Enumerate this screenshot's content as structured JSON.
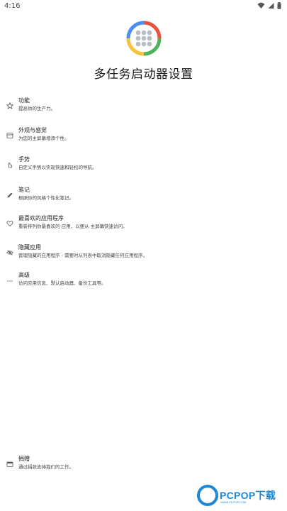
{
  "status_bar": {
    "time": "4:16",
    "icons": [
      "wifi-icon",
      "signal-icon",
      "battery-icon"
    ]
  },
  "app": {
    "title": "多任务启动器设置",
    "logo_icon": "app-grid-logo-icon"
  },
  "settings": [
    {
      "title": "功能",
      "subtitle": "提高你的生产力。",
      "icon": "star-icon"
    },
    {
      "title": "外观与感觉",
      "subtitle": "为您的主屏幕增添个性。",
      "icon": "palette-icon"
    },
    {
      "title": "手势",
      "subtitle": "自定义手势以实现快速和轻松的导航。",
      "icon": "gesture-hand-icon"
    },
    {
      "title": "笔记",
      "subtitle": "根据你的风格个性化笔记。",
      "icon": "pencil-icon"
    },
    {
      "title": "最喜欢的应用程序",
      "subtitle": "重新排列你最喜欢的 应用，以便从 主屏幕快速访问。",
      "icon": "heart-icon"
    },
    {
      "title": "隐藏应用",
      "subtitle": "管理隐藏的应用程序 - 需要时从列表中取消隐藏任何应用程序。",
      "icon": "eye-hidden-icon"
    },
    {
      "title": "高级",
      "subtitle": "访问应用信息、默认启动器、备份工具等。",
      "icon": "more-icon"
    }
  ],
  "about": {
    "title": "捐赠",
    "subtitle": "通过捐款支持我们的工作。",
    "icon": "donate-icon"
  },
  "watermark": {
    "brand": "PCPOP下载",
    "sub": "WWW.PCPOP.COM"
  },
  "colors": {
    "logo_red": "#e8543f",
    "logo_yellow": "#f6c33b",
    "logo_green": "#4fb35b",
    "logo_blue": "#4d8ef0",
    "logo_dots": "#b9bdc4",
    "watermark_blue": "#1d88d6"
  }
}
